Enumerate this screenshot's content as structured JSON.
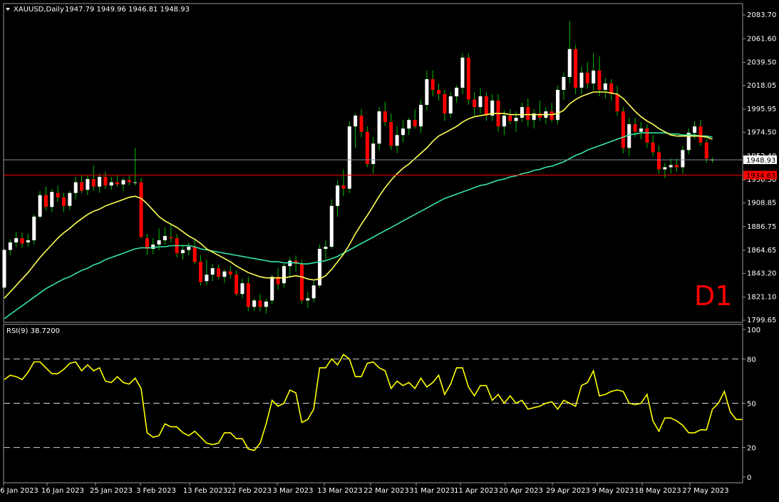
{
  "header": {
    "symbol": "XAUUSD,Daily",
    "ohlc": "1947.79 1949.96 1946.81 1948.93"
  },
  "timeframe_label": "D1",
  "colors": {
    "background": "#000000",
    "frame": "#9a9a9a",
    "bull": "#ffffff",
    "bear": "#ff0000",
    "wick": "#00c000",
    "ma_fast": "#ffff55",
    "ma_slow": "#36e6a3",
    "rsi": "#ffff00",
    "bid_line": "#7f8fa0",
    "level_line": "#ff0000",
    "label": "#ff0000"
  },
  "price_panel": {
    "y_ticks": [
      "2083.70",
      "2061.60",
      "2039.50",
      "2018.05",
      "1995.95",
      "1974.50",
      "1952.40",
      "1930.30",
      "1908.85",
      "1886.75",
      "1864.65",
      "1843.20",
      "1821.10",
      "1799.65"
    ],
    "current_price": "1948.93",
    "level_price": "1934.63"
  },
  "rsi_panel": {
    "label": "RSI(9) 38.7200",
    "y_ticks": [
      "100",
      "80",
      "50",
      "20",
      "0"
    ],
    "levels": [
      80,
      50,
      20
    ]
  },
  "x_ticks": [
    "6 Jan 2023",
    "16 Jan 2023",
    "25 Jan 2023",
    "3 Feb 2023",
    "13 Feb 2023",
    "22 Feb 2023",
    "3 Mar 2023",
    "13 Mar 2023",
    "22 Mar 2023",
    "31 Mar 2023",
    "11 Apr 2023",
    "20 Apr 2023",
    "29 Apr 2023",
    "9 May 2023",
    "18 May 2023",
    "27 May 2023"
  ],
  "chart_data": {
    "type": "candlestick",
    "symbol": "XAUUSD",
    "timeframe": "Daily",
    "price_range": [
      1799.65,
      2083.7
    ],
    "rsi_range": [
      0,
      100
    ],
    "candles": [
      {
        "o": 1830,
        "h": 1866,
        "l": 1829,
        "c": 1865
      },
      {
        "o": 1865,
        "h": 1875,
        "l": 1860,
        "c": 1872
      },
      {
        "o": 1872,
        "h": 1882,
        "l": 1868,
        "c": 1876
      },
      {
        "o": 1876,
        "h": 1881,
        "l": 1867,
        "c": 1871
      },
      {
        "o": 1872,
        "h": 1880,
        "l": 1868,
        "c": 1874
      },
      {
        "o": 1874,
        "h": 1898,
        "l": 1870,
        "c": 1896
      },
      {
        "o": 1896,
        "h": 1920,
        "l": 1894,
        "c": 1916
      },
      {
        "o": 1916,
        "h": 1924,
        "l": 1902,
        "c": 1905
      },
      {
        "o": 1905,
        "h": 1922,
        "l": 1900,
        "c": 1919
      },
      {
        "o": 1918,
        "h": 1925,
        "l": 1910,
        "c": 1914
      },
      {
        "o": 1914,
        "h": 1918,
        "l": 1900,
        "c": 1906
      },
      {
        "o": 1906,
        "h": 1920,
        "l": 1902,
        "c": 1918
      },
      {
        "o": 1918,
        "h": 1933,
        "l": 1912,
        "c": 1928
      },
      {
        "o": 1928,
        "h": 1935,
        "l": 1918,
        "c": 1920
      },
      {
        "o": 1921,
        "h": 1934,
        "l": 1916,
        "c": 1931
      },
      {
        "o": 1931,
        "h": 1944,
        "l": 1920,
        "c": 1924
      },
      {
        "o": 1924,
        "h": 1936,
        "l": 1918,
        "c": 1933
      },
      {
        "o": 1933,
        "h": 1938,
        "l": 1922,
        "c": 1925
      },
      {
        "o": 1925,
        "h": 1933,
        "l": 1921,
        "c": 1928
      },
      {
        "o": 1928,
        "h": 1935,
        "l": 1924,
        "c": 1926
      },
      {
        "o": 1926,
        "h": 1932,
        "l": 1920,
        "c": 1930
      },
      {
        "o": 1930,
        "h": 1934,
        "l": 1925,
        "c": 1928
      },
      {
        "o": 1928,
        "h": 1960,
        "l": 1925,
        "c": 1928
      },
      {
        "o": 1928,
        "h": 1932,
        "l": 1876,
        "c": 1877
      },
      {
        "o": 1876,
        "h": 1880,
        "l": 1860,
        "c": 1866
      },
      {
        "o": 1866,
        "h": 1876,
        "l": 1861,
        "c": 1870
      },
      {
        "o": 1870,
        "h": 1885,
        "l": 1865,
        "c": 1874
      },
      {
        "o": 1874,
        "h": 1886,
        "l": 1870,
        "c": 1878
      },
      {
        "o": 1877,
        "h": 1890,
        "l": 1872,
        "c": 1876
      },
      {
        "o": 1876,
        "h": 1880,
        "l": 1858,
        "c": 1862
      },
      {
        "o": 1862,
        "h": 1870,
        "l": 1856,
        "c": 1865
      },
      {
        "o": 1865,
        "h": 1872,
        "l": 1860,
        "c": 1868
      },
      {
        "o": 1868,
        "h": 1874,
        "l": 1852,
        "c": 1854
      },
      {
        "o": 1854,
        "h": 1860,
        "l": 1832,
        "c": 1835
      },
      {
        "o": 1836,
        "h": 1856,
        "l": 1832,
        "c": 1842
      },
      {
        "o": 1842,
        "h": 1852,
        "l": 1836,
        "c": 1848
      },
      {
        "o": 1848,
        "h": 1851,
        "l": 1838,
        "c": 1840
      },
      {
        "o": 1840,
        "h": 1847,
        "l": 1834,
        "c": 1845
      },
      {
        "o": 1845,
        "h": 1850,
        "l": 1838,
        "c": 1842
      },
      {
        "o": 1842,
        "h": 1846,
        "l": 1822,
        "c": 1824
      },
      {
        "o": 1824,
        "h": 1838,
        "l": 1820,
        "c": 1834
      },
      {
        "o": 1834,
        "h": 1840,
        "l": 1808,
        "c": 1812
      },
      {
        "o": 1812,
        "h": 1820,
        "l": 1808,
        "c": 1818
      },
      {
        "o": 1818,
        "h": 1824,
        "l": 1808,
        "c": 1812
      },
      {
        "o": 1812,
        "h": 1820,
        "l": 1806,
        "c": 1817
      },
      {
        "o": 1818,
        "h": 1842,
        "l": 1815,
        "c": 1840
      },
      {
        "o": 1840,
        "h": 1848,
        "l": 1828,
        "c": 1833
      },
      {
        "o": 1834,
        "h": 1852,
        "l": 1830,
        "c": 1850
      },
      {
        "o": 1850,
        "h": 1858,
        "l": 1840,
        "c": 1855
      },
      {
        "o": 1855,
        "h": 1860,
        "l": 1845,
        "c": 1852
      },
      {
        "o": 1852,
        "h": 1856,
        "l": 1815,
        "c": 1818
      },
      {
        "o": 1818,
        "h": 1826,
        "l": 1811,
        "c": 1820
      },
      {
        "o": 1820,
        "h": 1836,
        "l": 1816,
        "c": 1832
      },
      {
        "o": 1832,
        "h": 1870,
        "l": 1830,
        "c": 1866
      },
      {
        "o": 1866,
        "h": 1874,
        "l": 1856,
        "c": 1868
      },
      {
        "o": 1868,
        "h": 1912,
        "l": 1866,
        "c": 1906
      },
      {
        "o": 1906,
        "h": 1930,
        "l": 1896,
        "c": 1925
      },
      {
        "o": 1925,
        "h": 1940,
        "l": 1915,
        "c": 1922
      },
      {
        "o": 1922,
        "h": 1985,
        "l": 1918,
        "c": 1980
      },
      {
        "o": 1980,
        "h": 1992,
        "l": 1960,
        "c": 1990
      },
      {
        "o": 1990,
        "h": 1996,
        "l": 1970,
        "c": 1975
      },
      {
        "o": 1975,
        "h": 1980,
        "l": 1942,
        "c": 1945
      },
      {
        "o": 1945,
        "h": 1970,
        "l": 1936,
        "c": 1964
      },
      {
        "o": 1964,
        "h": 1998,
        "l": 1958,
        "c": 1994
      },
      {
        "o": 1994,
        "h": 2003,
        "l": 1980,
        "c": 1984
      },
      {
        "o": 1984,
        "h": 1992,
        "l": 1958,
        "c": 1962
      },
      {
        "o": 1962,
        "h": 1980,
        "l": 1955,
        "c": 1972
      },
      {
        "o": 1972,
        "h": 1986,
        "l": 1965,
        "c": 1978
      },
      {
        "o": 1978,
        "h": 1988,
        "l": 1972,
        "c": 1986
      },
      {
        "o": 1986,
        "h": 1996,
        "l": 1978,
        "c": 1980
      },
      {
        "o": 1980,
        "h": 2005,
        "l": 1974,
        "c": 2000
      },
      {
        "o": 2000,
        "h": 2032,
        "l": 1995,
        "c": 2024
      },
      {
        "o": 2024,
        "h": 2032,
        "l": 2008,
        "c": 2014
      },
      {
        "o": 2014,
        "h": 2020,
        "l": 2004,
        "c": 2010
      },
      {
        "o": 2010,
        "h": 2014,
        "l": 1985,
        "c": 1992
      },
      {
        "o": 1992,
        "h": 2012,
        "l": 1988,
        "c": 2008
      },
      {
        "o": 2008,
        "h": 2018,
        "l": 2002,
        "c": 2016
      },
      {
        "o": 2016,
        "h": 2048,
        "l": 2010,
        "c": 2044
      },
      {
        "o": 2044,
        "h": 2048,
        "l": 2000,
        "c": 2005
      },
      {
        "o": 2005,
        "h": 2012,
        "l": 1990,
        "c": 1998
      },
      {
        "o": 1998,
        "h": 2016,
        "l": 1992,
        "c": 2008
      },
      {
        "o": 2008,
        "h": 2012,
        "l": 1985,
        "c": 1990
      },
      {
        "o": 1990,
        "h": 2010,
        "l": 1985,
        "c": 2004
      },
      {
        "o": 2004,
        "h": 2010,
        "l": 1975,
        "c": 1980
      },
      {
        "o": 1980,
        "h": 1995,
        "l": 1972,
        "c": 1990
      },
      {
        "o": 1990,
        "h": 1996,
        "l": 1982,
        "c": 1985
      },
      {
        "o": 1985,
        "h": 1994,
        "l": 1975,
        "c": 1988
      },
      {
        "o": 1988,
        "h": 2002,
        "l": 1984,
        "c": 1998
      },
      {
        "o": 1998,
        "h": 2006,
        "l": 1980,
        "c": 1986
      },
      {
        "o": 1986,
        "h": 1996,
        "l": 1978,
        "c": 1992
      },
      {
        "o": 1992,
        "h": 2004,
        "l": 1985,
        "c": 1988
      },
      {
        "o": 1988,
        "h": 1998,
        "l": 1982,
        "c": 1994
      },
      {
        "o": 1994,
        "h": 2002,
        "l": 1984,
        "c": 1986
      },
      {
        "o": 1986,
        "h": 2018,
        "l": 1982,
        "c": 2014
      },
      {
        "o": 2014,
        "h": 2030,
        "l": 2005,
        "c": 2026
      },
      {
        "o": 2026,
        "h": 2078,
        "l": 2020,
        "c": 2052
      },
      {
        "o": 2052,
        "h": 2056,
        "l": 2010,
        "c": 2016
      },
      {
        "o": 2016,
        "h": 2036,
        "l": 2010,
        "c": 2030
      },
      {
        "o": 2030,
        "h": 2040,
        "l": 2015,
        "c": 2020
      },
      {
        "o": 2020,
        "h": 2048,
        "l": 2014,
        "c": 2032
      },
      {
        "o": 2032,
        "h": 2045,
        "l": 2008,
        "c": 2014
      },
      {
        "o": 2014,
        "h": 2025,
        "l": 2006,
        "c": 2020
      },
      {
        "o": 2020,
        "h": 2024,
        "l": 2004,
        "c": 2010
      },
      {
        "o": 2010,
        "h": 2018,
        "l": 1990,
        "c": 1994
      },
      {
        "o": 1994,
        "h": 1998,
        "l": 1955,
        "c": 1960
      },
      {
        "o": 1960,
        "h": 1988,
        "l": 1952,
        "c": 1982
      },
      {
        "o": 1982,
        "h": 1988,
        "l": 1970,
        "c": 1975
      },
      {
        "o": 1975,
        "h": 1984,
        "l": 1968,
        "c": 1978
      },
      {
        "o": 1978,
        "h": 1982,
        "l": 1960,
        "c": 1965
      },
      {
        "o": 1965,
        "h": 1972,
        "l": 1952,
        "c": 1956
      },
      {
        "o": 1956,
        "h": 1962,
        "l": 1936,
        "c": 1940
      },
      {
        "o": 1940,
        "h": 1946,
        "l": 1932,
        "c": 1942
      },
      {
        "o": 1942,
        "h": 1950,
        "l": 1936,
        "c": 1944
      },
      {
        "o": 1944,
        "h": 1950,
        "l": 1938,
        "c": 1942
      },
      {
        "o": 1942,
        "h": 1962,
        "l": 1936,
        "c": 1958
      },
      {
        "o": 1958,
        "h": 1978,
        "l": 1954,
        "c": 1974
      },
      {
        "o": 1974,
        "h": 1985,
        "l": 1968,
        "c": 1980
      },
      {
        "o": 1980,
        "h": 1986,
        "l": 1962,
        "c": 1965
      },
      {
        "o": 1965,
        "h": 1968,
        "l": 1946,
        "c": 1950
      },
      {
        "o": 1949,
        "h": 1951,
        "l": 1946,
        "c": 1949
      }
    ],
    "ma_fast": [
      1820,
      1826,
      1832,
      1838,
      1844,
      1851,
      1858,
      1864,
      1870,
      1876,
      1881,
      1885,
      1890,
      1894,
      1898,
      1901,
      1903,
      1906,
      1908,
      1910,
      1912,
      1914,
      1915,
      1913,
      1908,
      1902,
      1896,
      1892,
      1889,
      1886,
      1882,
      1878,
      1875,
      1871,
      1866,
      1863,
      1860,
      1857,
      1854,
      1850,
      1847,
      1844,
      1842,
      1840,
      1839,
      1839,
      1839,
      1839,
      1840,
      1841,
      1840,
      1838,
      1837,
      1838,
      1841,
      1847,
      1854,
      1861,
      1870,
      1880,
      1889,
      1897,
      1906,
      1915,
      1923,
      1930,
      1936,
      1941,
      1945,
      1950,
      1955,
      1960,
      1966,
      1971,
      1974,
      1977,
      1980,
      1984,
      1987,
      1989,
      1990,
      1991,
      1992,
      1992,
      1992,
      1991,
      1991,
      1991,
      1991,
      1991,
      1991,
      1991,
      1991,
      1992,
      1995,
      2001,
      2005,
      2008,
      2010,
      2012,
      2012,
      2012,
      2011,
      2010,
      2006,
      2000,
      1994,
      1989,
      1985,
      1982,
      1978,
      1975,
      1972,
      1971,
      1971,
      1971,
      1971,
      1971,
      1970,
      1968
    ],
    "ma_slow": [
      1801,
      1805,
      1809,
      1813,
      1817,
      1821,
      1825,
      1829,
      1832,
      1835,
      1838,
      1840,
      1843,
      1846,
      1848,
      1851,
      1853,
      1856,
      1858,
      1860,
      1862,
      1864,
      1866,
      1867,
      1867,
      1867,
      1868,
      1868,
      1869,
      1869,
      1869,
      1869,
      1868,
      1866,
      1865,
      1864,
      1863,
      1862,
      1861,
      1860,
      1859,
      1858,
      1857,
      1856,
      1855,
      1854,
      1854,
      1853,
      1853,
      1853,
      1852,
      1852,
      1853,
      1854,
      1855,
      1857,
      1859,
      1862,
      1865,
      1868,
      1871,
      1874,
      1877,
      1880,
      1883,
      1886,
      1889,
      1892,
      1895,
      1898,
      1901,
      1904,
      1907,
      1910,
      1913,
      1915,
      1917,
      1919,
      1921,
      1923,
      1925,
      1926,
      1928,
      1930,
      1931,
      1933,
      1934,
      1936,
      1937,
      1939,
      1940,
      1942,
      1943,
      1945,
      1947,
      1950,
      1953,
      1955,
      1958,
      1960,
      1962,
      1964,
      1966,
      1968,
      1970,
      1972,
      1973,
      1974,
      1974,
      1974,
      1974,
      1974,
      1973,
      1973,
      1972,
      1972,
      1972,
      1971,
      1971,
      1970
    ],
    "rsi": [
      66,
      69,
      68,
      66,
      71,
      78,
      78,
      74,
      70,
      70,
      73,
      77,
      78,
      72,
      76,
      72,
      74,
      65,
      64,
      68,
      64,
      63,
      67,
      60,
      30,
      27,
      28,
      36,
      34,
      34,
      30,
      28,
      31,
      27,
      23,
      22,
      23,
      30,
      30,
      26,
      26,
      19,
      18,
      23,
      36,
      52,
      48,
      50,
      59,
      57,
      37,
      39,
      46,
      74,
      74,
      80,
      76,
      83,
      80,
      68,
      68,
      77,
      78,
      74,
      72,
      60,
      65,
      62,
      64,
      60,
      67,
      61,
      64,
      69,
      56,
      63,
      74,
      74,
      61,
      55,
      62,
      62,
      52,
      56,
      50,
      55,
      50,
      52,
      46,
      47,
      48,
      50,
      51,
      46,
      52,
      50,
      48,
      62,
      64,
      72,
      55,
      56,
      58,
      59,
      58,
      50,
      49,
      50,
      56,
      38,
      31,
      40,
      40,
      38,
      35,
      30,
      30,
      32,
      32,
      46,
      50,
      58,
      44,
      39,
      39
    ]
  }
}
